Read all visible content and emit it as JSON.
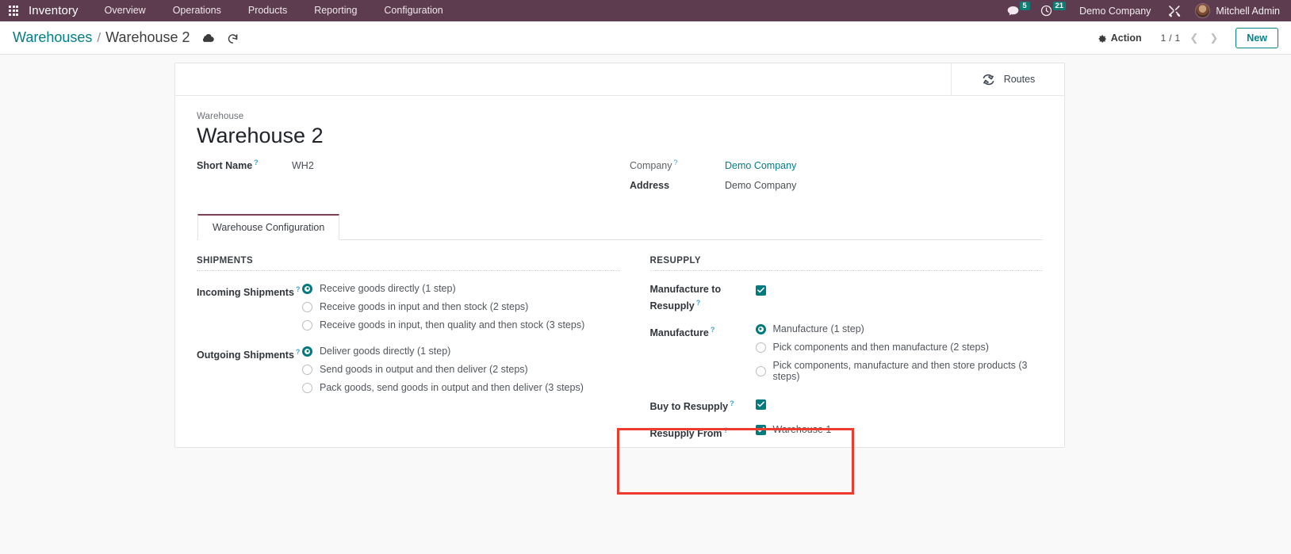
{
  "navbar": {
    "apps_icon": "grid-apps-icon",
    "brand": "Inventory",
    "menus": [
      "Overview",
      "Operations",
      "Products",
      "Reporting",
      "Configuration"
    ],
    "messages_icon": "chat-bubble-icon",
    "messages_count": "5",
    "activities_icon": "clock-icon",
    "activities_count": "21",
    "company": "Demo Company",
    "tools_icon": "wrench-screwdriver-icon",
    "avatar_icon": "user-avatar",
    "user": "Mitchell Admin",
    "bg_color": "#5c3c4e",
    "badge_color": "#0d7d76"
  },
  "control_panel": {
    "breadcrumb_parent": "Warehouses",
    "breadcrumb_separator": "/",
    "breadcrumb_current": "Warehouse 2",
    "save_icon": "cloud-save-icon",
    "discard_icon": "undo-discard-icon",
    "action_icon": "gear-icon",
    "action_label": "Action",
    "pager": "1 / 1",
    "prev_icon": "chevron-left-icon",
    "next_icon": "chevron-right-icon",
    "new_label": "New",
    "accent_color": "#01838a"
  },
  "stat_buttons": [
    {
      "icon": "refresh-cycle-icon",
      "label": "Routes"
    }
  ],
  "form": {
    "name_caption": "Warehouse",
    "name_value": "Warehouse 2",
    "short_name_label": "Short Name",
    "short_name_value": "WH2",
    "company_label": "Company",
    "company_value": "Demo Company",
    "address_label": "Address",
    "address_value": "Demo Company",
    "help_marker": "?"
  },
  "notebook": {
    "tabs": [
      {
        "label": "Warehouse Configuration",
        "active": true
      }
    ],
    "active_tab_border_color": "#7d3f52"
  },
  "shipments": {
    "title": "SHIPMENTS",
    "incoming": {
      "label": "Incoming Shipments",
      "options": [
        {
          "text": "Receive goods directly (1 step)",
          "selected": true
        },
        {
          "text": "Receive goods in input and then stock (2 steps)",
          "selected": false
        },
        {
          "text": "Receive goods in input, then quality and then stock (3 steps)",
          "selected": false
        }
      ]
    },
    "outgoing": {
      "label": "Outgoing Shipments",
      "options": [
        {
          "text": "Deliver goods directly (1 step)",
          "selected": true
        },
        {
          "text": "Send goods in output and then deliver (2 steps)",
          "selected": false
        },
        {
          "text": "Pack goods, send goods in output and then deliver (3 steps)",
          "selected": false
        }
      ]
    }
  },
  "resupply": {
    "title": "RESUPPLY",
    "manufacture_to_resupply": {
      "label": "Manufacture to Resupply",
      "checked": true
    },
    "manufacture": {
      "label": "Manufacture",
      "options": [
        {
          "text": "Manufacture (1 step)",
          "selected": true
        },
        {
          "text": "Pick components and then manufacture (2 steps)",
          "selected": false
        },
        {
          "text": "Pick components, manufacture and then store products (3 steps)",
          "selected": false
        }
      ]
    },
    "buy_to_resupply": {
      "label": "Buy to Resupply",
      "checked": true
    },
    "resupply_from": {
      "label": "Resupply From",
      "options": [
        {
          "text": "Warehouse 1",
          "checked": true
        }
      ]
    }
  },
  "annotation": {
    "type": "highlight-rectangle",
    "color": "#ef3b2d"
  }
}
